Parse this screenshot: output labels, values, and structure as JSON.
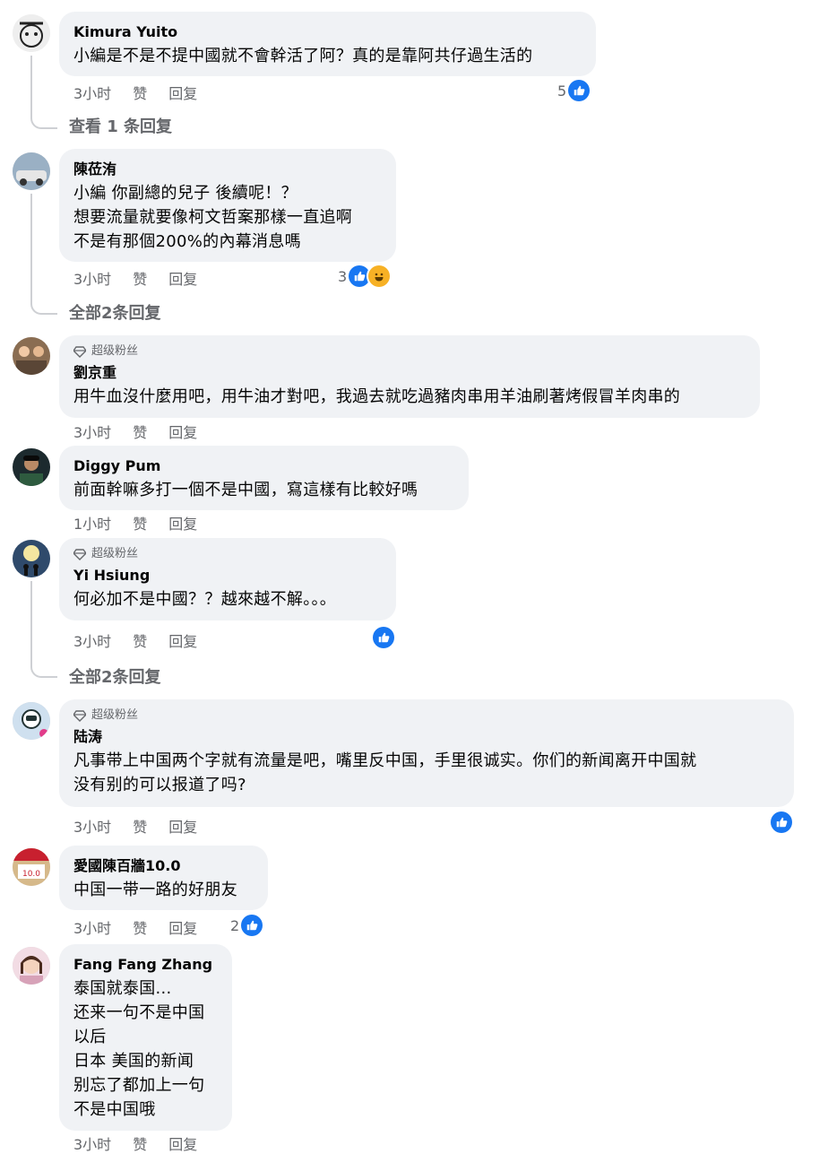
{
  "colors": {
    "bubble": "#f0f2f5",
    "meta": "#65676b",
    "like": "#1877f2",
    "haha": "#f7b125"
  },
  "comments": [
    {
      "name": "Kimura Yuito",
      "text": "小編是不是不提中國就不會幹活了阿？真的是靠阿共仔過生活的",
      "time": "3小时",
      "like_label": "赞",
      "reply_label": "回复",
      "reaction_count": "5",
      "reactions": [
        "like-icon"
      ],
      "more_replies": "查看 1 条回复"
    },
    {
      "name": "陳莅洧",
      "text": "小編 你副總的兒子 後續呢！？\n想要流量就要像柯文哲案那樣一直追啊\n不是有那個200%的內幕消息嗎",
      "time": "3小时",
      "like_label": "赞",
      "reply_label": "回复",
      "reaction_count": "3",
      "reactions": [
        "like-icon",
        "haha-icon"
      ],
      "more_replies": "全部2条回复"
    },
    {
      "badge": "超级粉丝",
      "name": "劉京重",
      "text": "用牛血沒什麼用吧，用牛油才對吧，我過去就吃過豬肉串用羊油刷著烤假冒羊肉串的",
      "time": "3小时",
      "like_label": "赞",
      "reply_label": "回复"
    },
    {
      "name": "Diggy Pum",
      "text": "前面幹嘛多打一個不是中國，寫這樣有比較好嗎",
      "time": "1小时",
      "like_label": "赞",
      "reply_label": "回复"
    },
    {
      "badge": "超级粉丝",
      "name": "Yi Hsiung",
      "text": "何必加不是中國？？越來越不解。。。",
      "time": "3小时",
      "like_label": "赞",
      "reply_label": "回复",
      "reactions": [
        "like-icon"
      ],
      "more_replies": "全部2条回复"
    },
    {
      "badge": "超级粉丝",
      "name": "陆涛",
      "text": "凡事带上中国两个字就有流量是吧，嘴里反中国，手里很诚实。你们的新闻离开中国就\n没有别的可以报道了吗?",
      "time": "3小时",
      "like_label": "赞",
      "reply_label": "回复",
      "reactions": [
        "like-icon"
      ]
    },
    {
      "name": "愛國陳百牆10.0",
      "text": "中国一带一路的好朋友",
      "time": "3小时",
      "like_label": "赞",
      "reply_label": "回复",
      "reaction_count": "2",
      "reactions": [
        "like-icon"
      ]
    },
    {
      "name": "Fang Fang Zhang",
      "text": "泰国就泰国...\n还来一句不是中国\n以后\n日本 美国的新闻\n别忘了都加上一句\n不是中国哦",
      "time": "3小时",
      "like_label": "赞",
      "reply_label": "回复"
    }
  ]
}
